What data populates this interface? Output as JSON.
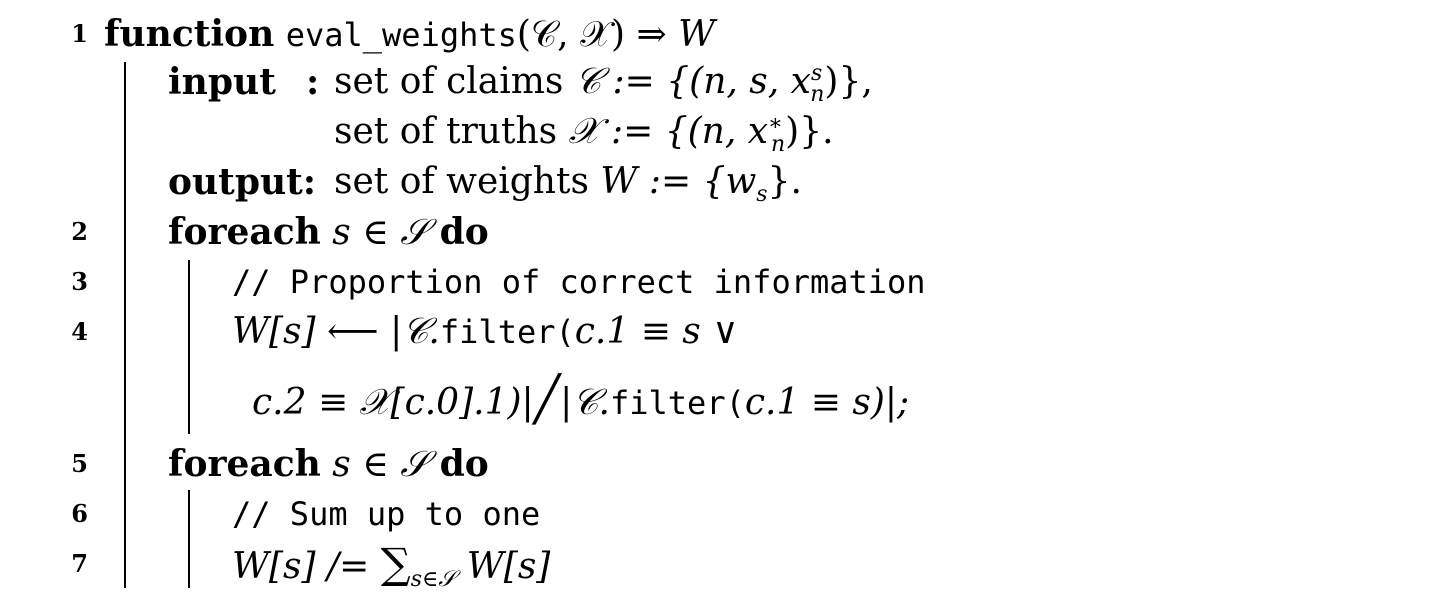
{
  "line_numbers": [
    "1",
    "2",
    "3",
    "4",
    "5",
    "6",
    "7"
  ],
  "header": {
    "keyword": "function",
    "name": "eval_weights",
    "args": "(𝒞, 𝒳) ⇒ ",
    "ret": "W"
  },
  "input": {
    "label": "input",
    "colon": ":",
    "line1_text": "set of claims ",
    "line1_math": "𝒞 := {(n, s, x",
    "line1_sup": "s",
    "line1_sub": "n",
    "line1_end": ")},",
    "line2_text": "set of truths ",
    "line2_math": "𝒳 := {(n, x",
    "line2_sup": "∗",
    "line2_sub": "n",
    "line2_end": ")}."
  },
  "output": {
    "label": "output:",
    "text": "set of weights ",
    "math": "W := {w",
    "sub": "s",
    "end": "}."
  },
  "loop1": {
    "keyword": "foreach",
    "cond": " s ∈ 𝒮 ",
    "do": "do",
    "comment": "// Proportion of correct information",
    "stmt_a": "W[s] ⟵ |𝒞.",
    "stmt_a_fn": "filter(",
    "stmt_a_end": "c.1 ≡ s ∨",
    "stmt_b": "c.2 ≡ 𝒳[c.0].1)|",
    "stmt_b_slash": "╱",
    "stmt_b2": "|𝒞.",
    "stmt_b_fn": "filter(",
    "stmt_b_end": "c.1 ≡ s)|;"
  },
  "loop2": {
    "keyword": "foreach",
    "cond": " s ∈ 𝒮 ",
    "do": "do",
    "comment": "// Sum up to one",
    "stmt_a": "W[s] /= ",
    "sum": "∑",
    "sum_sub": "s∈𝒮",
    "stmt_end": " W[s]"
  }
}
